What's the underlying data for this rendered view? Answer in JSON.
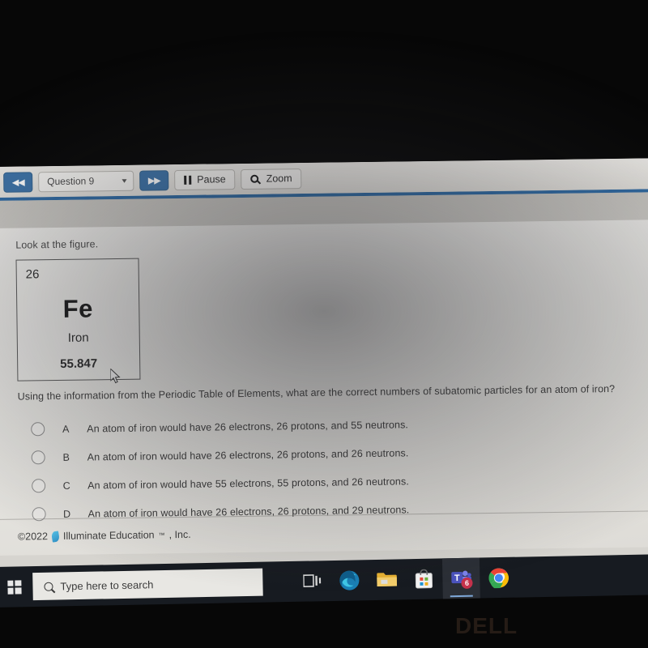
{
  "toolbar": {
    "prev_label": "◀◀",
    "question_selector": "Question 9",
    "chevron": "⌵",
    "next_label": "▶▶",
    "pause_label": "Pause",
    "zoom_label": "Zoom"
  },
  "quiz": {
    "prompt_intro": "Look at the figure.",
    "element": {
      "atomic_number": "26",
      "symbol": "Fe",
      "name": "Iron",
      "atomic_mass": "55.847"
    },
    "question": "Using the information from the Periodic Table of Elements, what are the correct numbers of subatomic particles for an atom of iron?",
    "choices": [
      {
        "letter": "A",
        "text": "An atom of iron would have 26 electrons, 26 protons, and 55 neutrons."
      },
      {
        "letter": "B",
        "text": "An atom of iron would have 26 electrons, 26 protons, and 26 neutrons."
      },
      {
        "letter": "C",
        "text": "An atom of iron would have 55 electrons, 55 protons, and 26 neutrons."
      },
      {
        "letter": "D",
        "text": "An atom of iron would have 26 electrons, 26 protons, and 29 neutrons."
      }
    ]
  },
  "footer": {
    "copyright": "©2022",
    "company": "Illuminate Education",
    "trademark": "™",
    "suffix": ", Inc."
  },
  "taskbar": {
    "search_placeholder": "Type here to search",
    "icons": [
      {
        "name": "task-view-icon",
        "label": "Task View"
      },
      {
        "name": "edge-icon",
        "label": "Microsoft Edge"
      },
      {
        "name": "file-explorer-icon",
        "label": "File Explorer"
      },
      {
        "name": "microsoft-store-icon",
        "label": "Microsoft Store"
      },
      {
        "name": "teams-icon",
        "label": "Microsoft Teams",
        "badge": "6"
      },
      {
        "name": "chrome-icon",
        "label": "Google Chrome"
      }
    ]
  },
  "device": {
    "brand": "DELL"
  },
  "colors": {
    "toolbar_accent": "#3d73a8",
    "rule_blue": "#2f6aa3",
    "taskbar_bg": "#171b21",
    "badge_red": "#c4314b"
  }
}
